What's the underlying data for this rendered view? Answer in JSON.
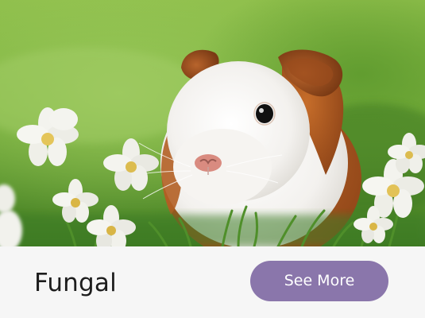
{
  "card": {
    "image_subject": "guinea-pig",
    "title": "Fungal",
    "button_label": "See More"
  },
  "colors": {
    "button_bg": "#8a76ab",
    "button_text": "#ffffff",
    "footer_bg": "#f6f6f6",
    "title_text": "#1d1d1d"
  }
}
